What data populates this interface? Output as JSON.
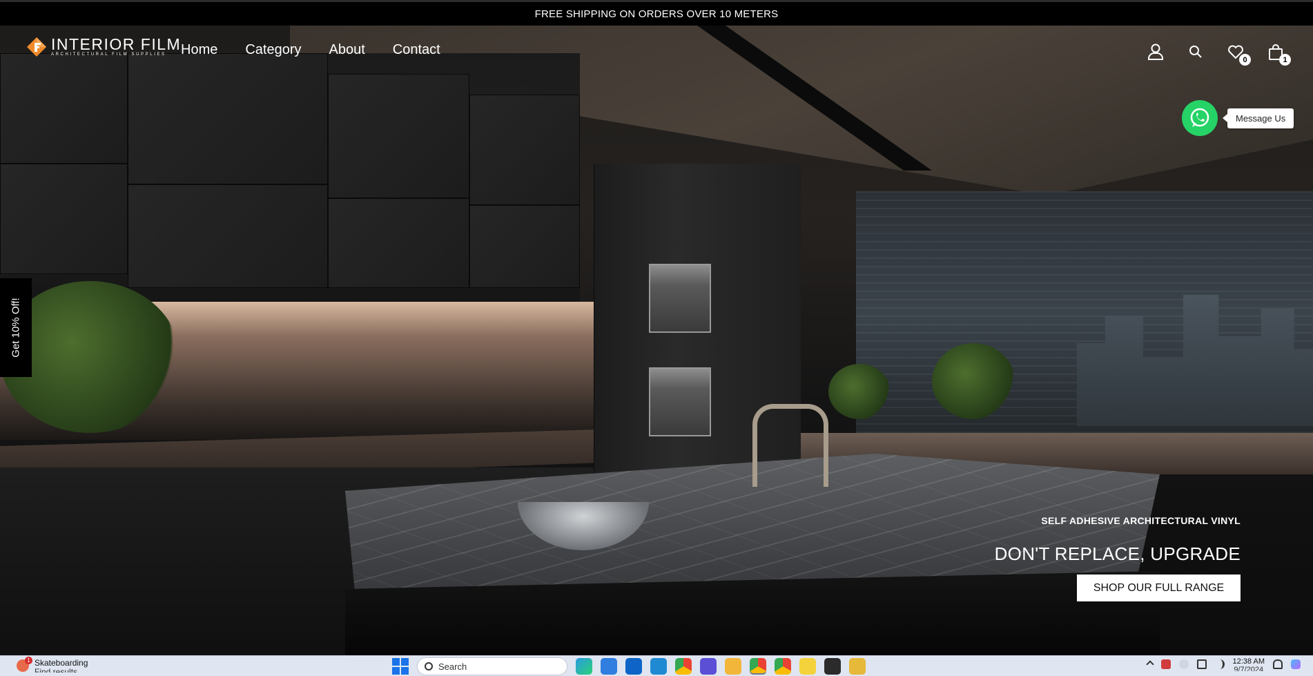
{
  "announcement": "FREE SHIPPING ON ORDERS OVER 10 METERS",
  "brand": {
    "name": "INTERIOR FILM",
    "tagline": "ARCHITECTURAL FILM SUPPLIES"
  },
  "nav": [
    "Home",
    "Category",
    "About",
    "Contact"
  ],
  "header_icons": {
    "wishlist_count": "0",
    "cart_count": "1"
  },
  "whatsapp": {
    "label": "Message Us"
  },
  "promo_tab": {
    "label": "Get 10% Off!"
  },
  "hero": {
    "eyebrow": "SELF ADHESIVE ARCHITECTURAL VINYL",
    "headline": "DON'T REPLACE, UPGRADE",
    "cta": "SHOP OUR FULL RANGE"
  },
  "taskbar": {
    "weather_badge": "1",
    "weather_title": "Skateboarding",
    "weather_sub": "Find results",
    "search_placeholder": "Search",
    "clock_time": "12:38 AM",
    "clock_date": "9/7/2024",
    "colors": {
      "start": "#1a73e8",
      "whatsapp": "#25d366"
    }
  }
}
